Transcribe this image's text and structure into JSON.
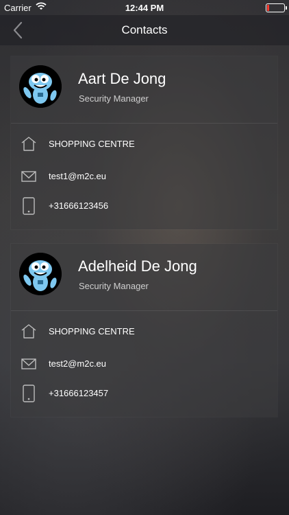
{
  "status_bar": {
    "carrier": "Carrier",
    "time": "12:44 PM",
    "battery_color": "#ff3b30"
  },
  "nav": {
    "title": "Contacts",
    "back_icon": "chevron-left-icon"
  },
  "contacts": [
    {
      "name": "Aart De Jong",
      "role": "Security Manager",
      "location": "SHOPPING CENTRE",
      "email": "test1@m2c.eu",
      "phone": "+31666123456"
    },
    {
      "name": "Adelheid De Jong",
      "role": "Security Manager",
      "location": "SHOPPING CENTRE",
      "email": "test2@m2c.eu",
      "phone": "+31666123457"
    }
  ],
  "icons": {
    "location": "home-icon",
    "email": "mail-icon",
    "phone": "phone-icon"
  },
  "colors": {
    "card_bg": "#3c3c3e",
    "text": "#ffffff",
    "subtext": "#cfcfcf",
    "avatar_mascot": "#7ec8f0"
  }
}
